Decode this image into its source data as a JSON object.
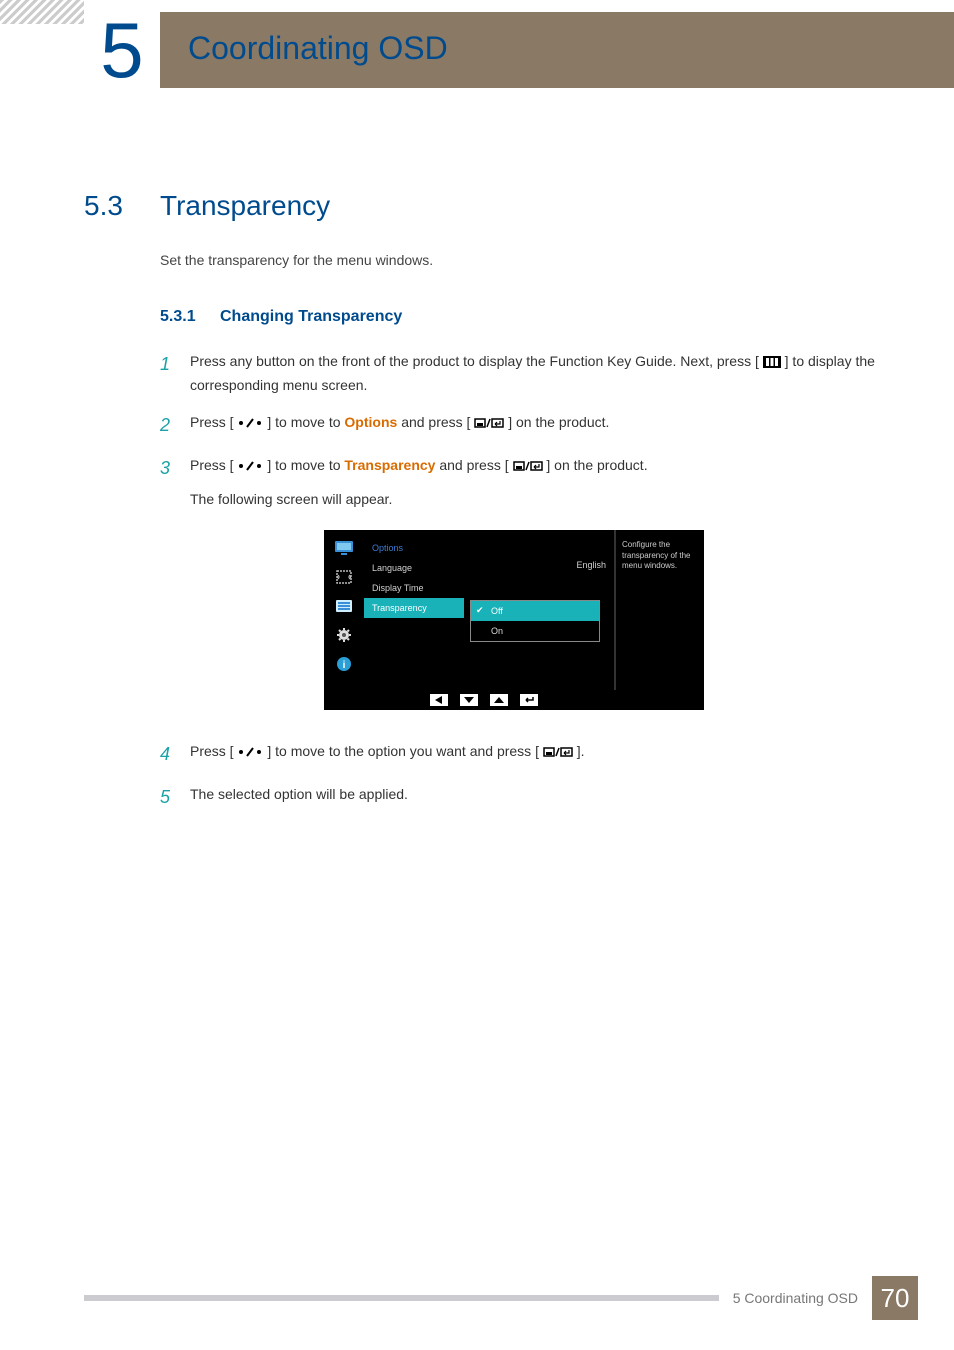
{
  "chapter": {
    "num": "5",
    "title": "Coordinating OSD"
  },
  "section": {
    "num": "5.3",
    "title": "Transparency",
    "intro": "Set the transparency for the menu windows."
  },
  "subsection": {
    "num": "5.3.1",
    "title": "Changing Transparency"
  },
  "steps": {
    "s1": {
      "n": "1",
      "a": "Press any button on the front of the product to display the Function Key Guide. Next, press [ ",
      "b": " ] to display the corresponding menu screen."
    },
    "s2": {
      "n": "2",
      "a": "Press [ ",
      "b": " ] to move to ",
      "kw": "Options",
      "c": " and press [",
      "d": "] on the product."
    },
    "s3": {
      "n": "3",
      "a": "Press [ ",
      "b": " ] to move to ",
      "kw": "Transparency",
      "c": " and press [",
      "d": "] on the product.",
      "e": "The following screen will appear."
    },
    "s4": {
      "n": "4",
      "a": "Press [ ",
      "b": " ] to move to the option you want and press [",
      "c": "]."
    },
    "s5": {
      "n": "5",
      "a": "The selected option will be applied."
    }
  },
  "osd": {
    "cat": "Options",
    "items": {
      "language": "Language",
      "language_val": "English",
      "display_time": "Display Time",
      "transparency": "Transparency"
    },
    "sub": {
      "off": "Off",
      "on": "On"
    },
    "help": "Configure the transparency of the menu windows."
  },
  "footer": {
    "text": "5 Coordinating OSD",
    "page": "70"
  }
}
